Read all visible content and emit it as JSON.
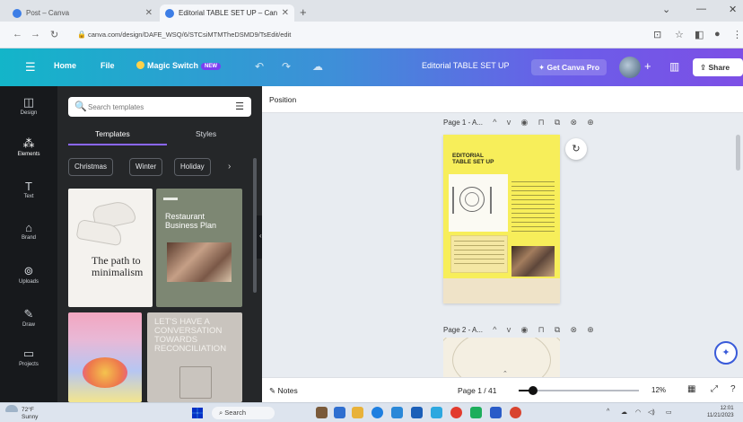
{
  "browser": {
    "tabs": [
      {
        "label": "Post – Canva",
        "active": false
      },
      {
        "label": "Editorial TABLE SET UP – Canva",
        "active": true
      }
    ],
    "new_tab": "+",
    "url": "canva.com/design/DAFE_WSQ/6/STCsiMTMTheDSMD9/TsEdit/edit",
    "window_controls": [
      "⌄",
      "—",
      "✕"
    ]
  },
  "topbar": {
    "menu_icon": "hamburger-icon",
    "home": "Home",
    "file": "File",
    "magic_switch": "Magic Switch",
    "new_badge": "NEW",
    "design_title": "Editorial TABLE SET UP",
    "get_pro": "✦ Get Canva Pro",
    "share": "Share"
  },
  "rail": [
    {
      "label": "Design",
      "icon": "layout-icon"
    },
    {
      "label": "Elements",
      "icon": "elements-icon"
    },
    {
      "label": "Text",
      "icon": "text-icon"
    },
    {
      "label": "Brand",
      "icon": "brand-icon"
    },
    {
      "label": "Uploads",
      "icon": "upload-icon"
    },
    {
      "label": "Draw",
      "icon": "draw-icon"
    },
    {
      "label": "Projects",
      "icon": "folder-icon"
    }
  ],
  "panel": {
    "search_placeholder": "Search templates",
    "tabs": [
      "Templates",
      "Styles"
    ],
    "chips": [
      "Christmas",
      "Winter",
      "Holiday"
    ],
    "templates": [
      {
        "text": "The path to minimalism"
      },
      {
        "text": "Restaurant Business Plan"
      },
      {
        "text": ""
      },
      {
        "text": "LET'S HAVE A CONVERSATION TOWARDS RECONCILIATION"
      }
    ]
  },
  "editor": {
    "position_label": "Position",
    "page1_label": "Page 1 - A...",
    "page2_label": "Page 2 - A...",
    "page_title": "EDITORIAL TABLE SET UP",
    "notes": "Notes",
    "page_indicator": "Page 1 / 41",
    "zoom": "12%",
    "zoom_fraction": 0.12
  },
  "taskbar": {
    "weather_temp": "72°F",
    "weather_desc": "Sunny",
    "search": "Search",
    "clock_time": "12:01",
    "clock_date": "11/21/2023"
  },
  "colors": {
    "topbar_start": "#13b5c9",
    "topbar_end": "#7d4fe6",
    "panel_bg": "#252729",
    "rail_bg": "#17191c",
    "accent": "#8b67ff",
    "page_yellow": "#f7ee5a"
  }
}
